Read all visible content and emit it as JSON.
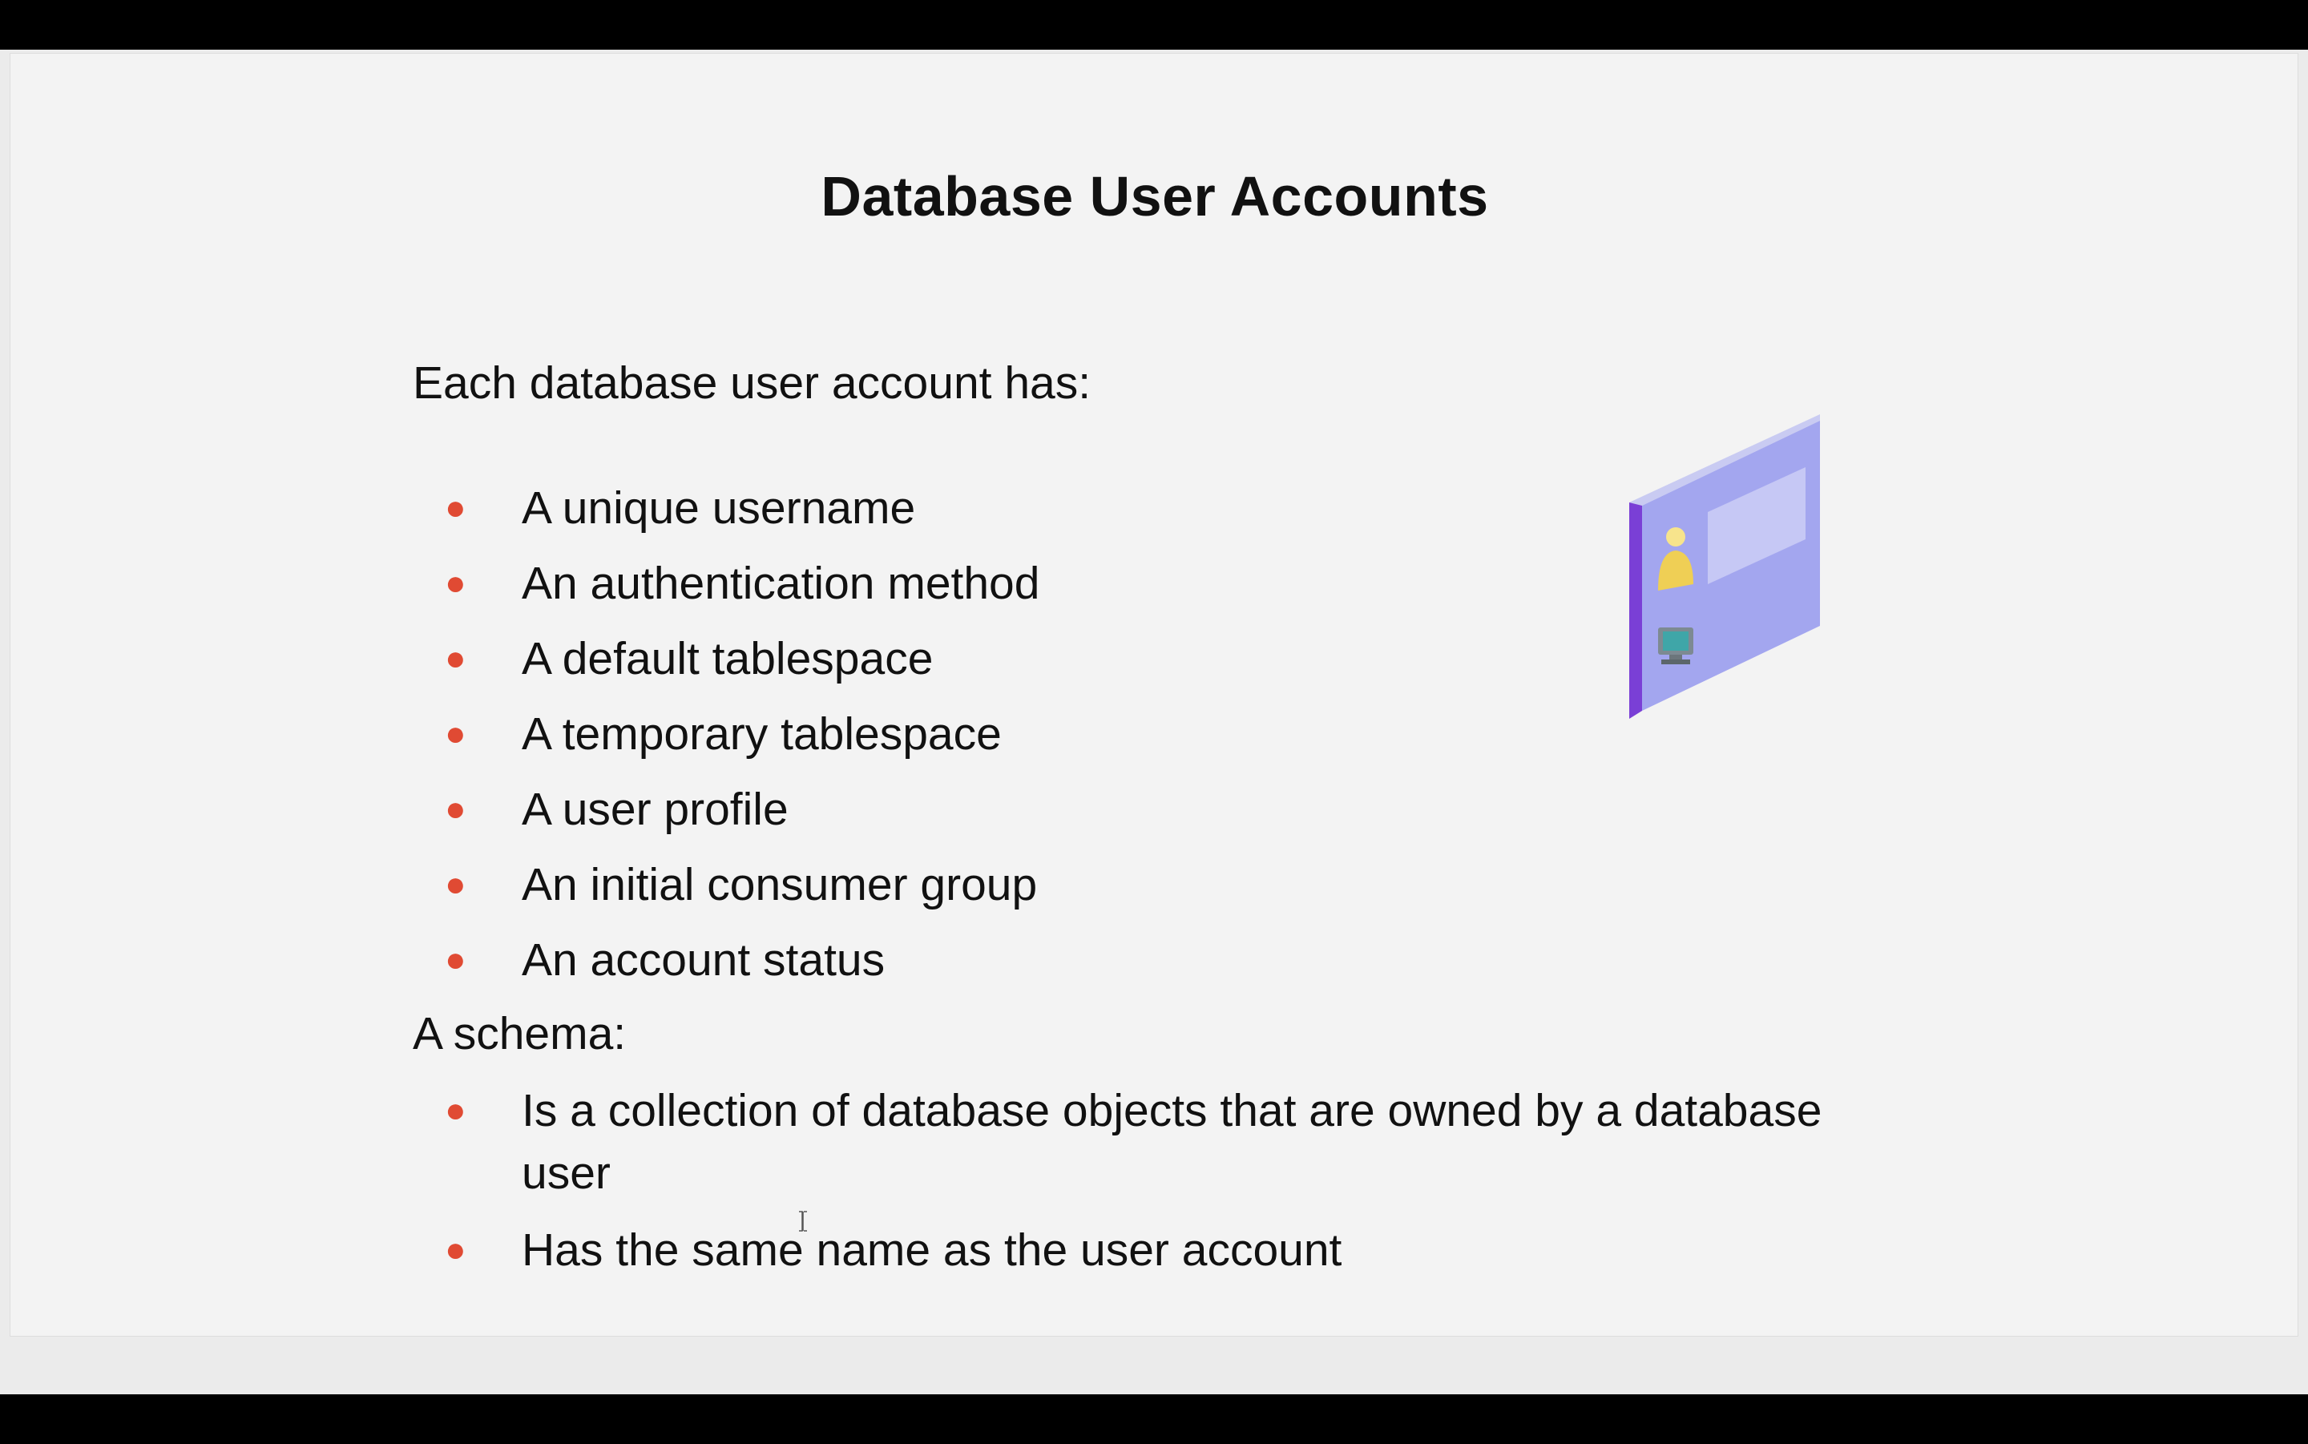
{
  "slide": {
    "title": "Database User Accounts",
    "section1": {
      "heading": "Each database user account has:",
      "bullets": [
        "A unique username",
        "An authentication method",
        "A default tablespace",
        "A temporary tablespace",
        "A user profile",
        "An initial consumer group",
        "An account status"
      ]
    },
    "section2": {
      "heading": "A schema:",
      "bullets": [
        "Is a collection of database objects that are owned by a database user",
        "Has the same name as the user account"
      ]
    },
    "bullet_color": "#e04a33",
    "illustration_icon": "user-account-panel-icon"
  },
  "watermark": {
    "icon": "brand-logo-icon"
  }
}
